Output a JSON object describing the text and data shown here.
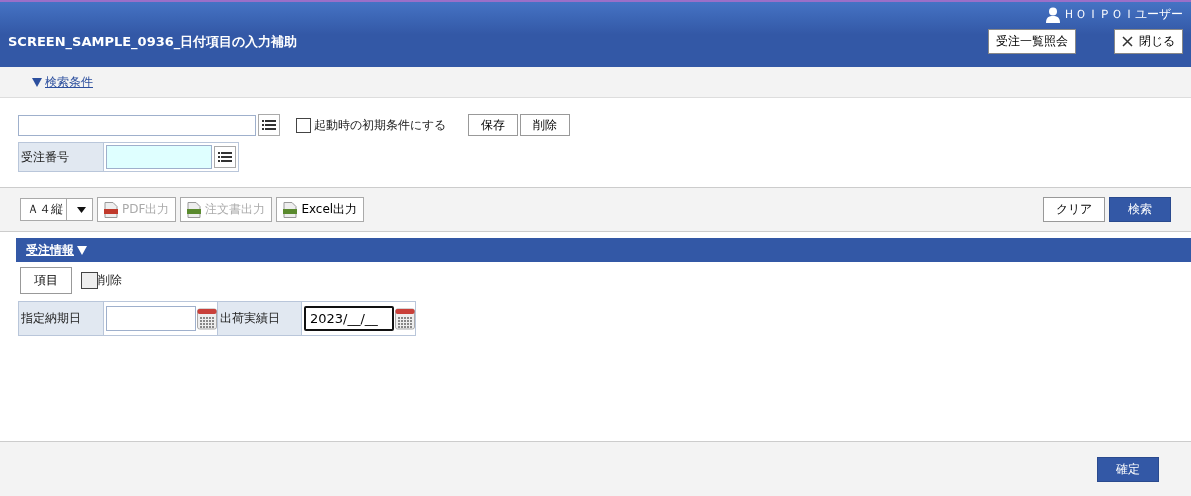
{
  "header": {
    "user": "ＨＯＩＰＯＩユーザー",
    "title": "SCREEN_SAMPLE_0936_日付項目の入力補助",
    "buttons": [
      {
        "label": "受注一覧照会",
        "kind": "text"
      },
      {
        "label": "閉じる",
        "kind": "close"
      }
    ]
  },
  "search_section": {
    "label": "検索条件",
    "expanded": true
  },
  "conditions": {
    "initial_checkbox": {
      "label": "起動時の初期条件にする",
      "checked": false
    },
    "buttons": [
      "保存",
      "削除"
    ],
    "field": {
      "label": "受注番号"
    }
  },
  "toolbar": {
    "paper": "Ａ４縦",
    "exports": [
      {
        "label": "PDF出力",
        "kind": "pdf",
        "disabled": true
      },
      {
        "label": "注文書出力",
        "kind": "doc",
        "disabled": true
      },
      {
        "label": "Excel出力",
        "kind": "excel",
        "disabled": false
      }
    ],
    "actions": [
      {
        "label": "クリア",
        "primary": false
      },
      {
        "label": "検索",
        "primary": true
      }
    ]
  },
  "order_section": {
    "label": "受注情報",
    "expanded": true
  },
  "order": {
    "item_button": "項目",
    "delete_checkbox": {
      "label": "削除",
      "checked": false
    },
    "date_fields": [
      {
        "label": "指定納期日",
        "focused": false
      },
      {
        "label": "出荷実績日",
        "value": "2023/__/__",
        "focused": true
      }
    ]
  },
  "footer": {
    "confirm": "確定"
  }
}
